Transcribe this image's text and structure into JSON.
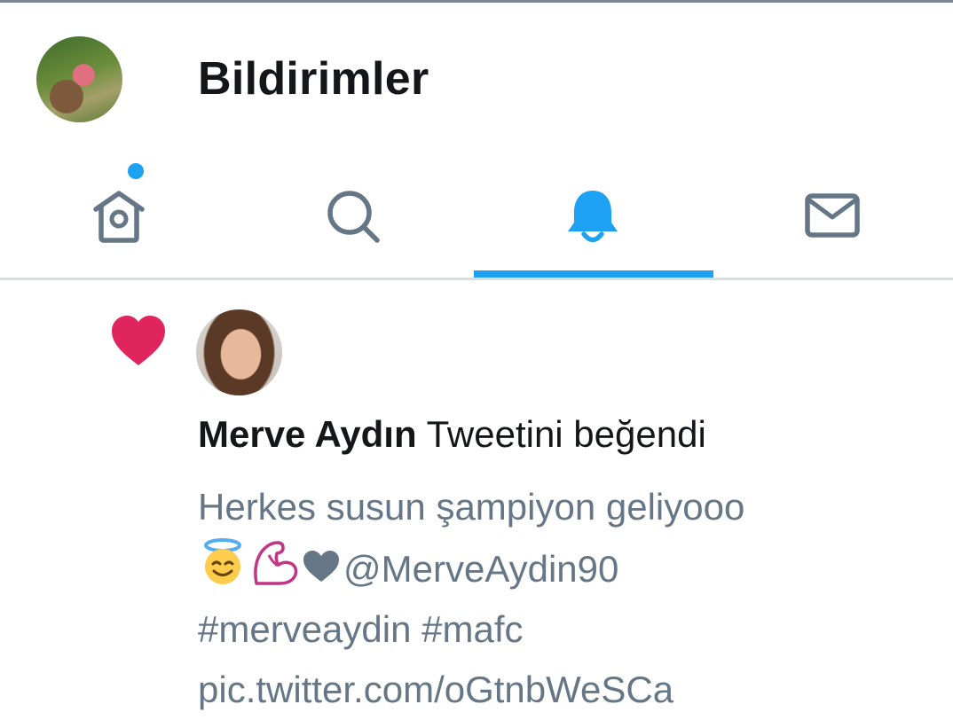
{
  "header": {
    "title": "Bildirimler"
  },
  "tabs": [
    {
      "name": "home",
      "icon": "home-icon",
      "active": false,
      "has_badge": true
    },
    {
      "name": "search",
      "icon": "search-icon",
      "active": false
    },
    {
      "name": "notifications",
      "icon": "bell-icon",
      "active": true
    },
    {
      "name": "messages",
      "icon": "envelope-icon",
      "active": false
    }
  ],
  "colors": {
    "accent": "#1da1f2",
    "heart": "#e0245e",
    "text_primary": "#14171a",
    "text_secondary": "#657786",
    "icon_inactive": "#657786"
  },
  "notification": {
    "icon": "heart-icon",
    "user_name": "Merve Aydın",
    "action_text": "Tweetini beğendi",
    "tweet_lines": [
      "Herkes susun şampiyon geliyooo",
      "@MerveAydin90",
      "#merveaydin #mafc",
      "pic.twitter.com/oGtnbWeSCa"
    ],
    "emojis": [
      "smiling-face-with-halo",
      "flexed-biceps",
      "heart"
    ]
  }
}
